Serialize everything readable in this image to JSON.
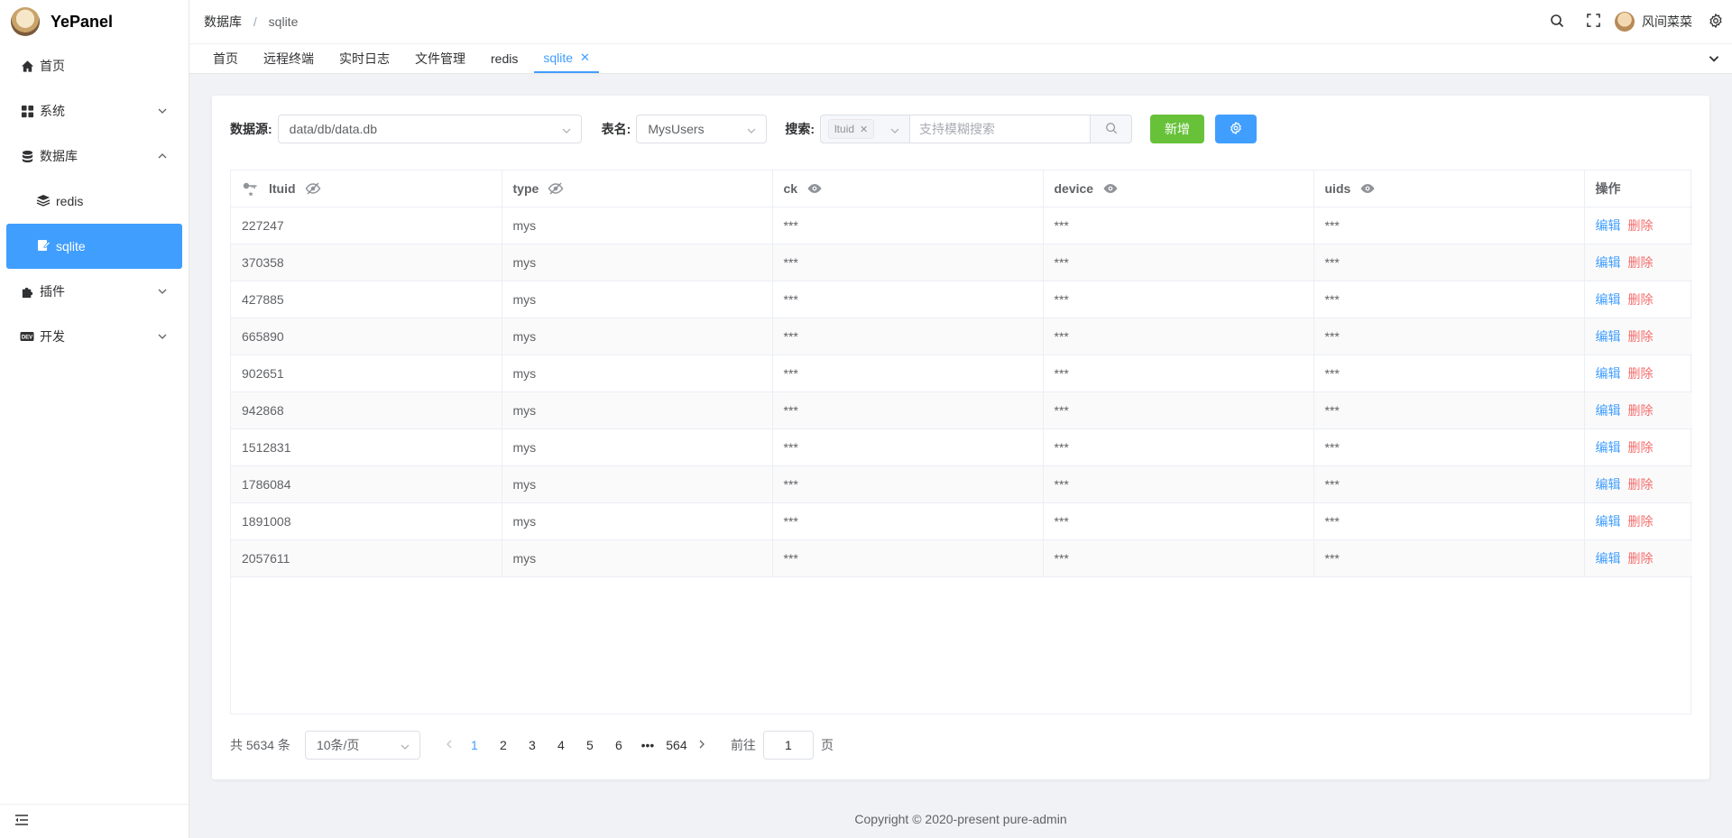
{
  "app": {
    "title": "YePanel"
  },
  "sidebar": {
    "items": [
      {
        "label": "首页",
        "icon": "home-icon"
      },
      {
        "label": "系统",
        "icon": "grid-icon"
      },
      {
        "label": "数据库",
        "icon": "database-icon"
      },
      {
        "label": "redis",
        "icon": "layers-icon"
      },
      {
        "label": "sqlite",
        "icon": "edit-doc-icon"
      },
      {
        "label": "插件",
        "icon": "puzzle-icon"
      },
      {
        "label": "开发",
        "icon": "dev-icon"
      }
    ]
  },
  "header": {
    "breadcrumb": [
      "数据库",
      "sqlite"
    ],
    "breadcrumb_sep": "/",
    "user_name": "风间菜菜"
  },
  "tabs": {
    "items": [
      "首页",
      "远程终端",
      "实时日志",
      "文件管理",
      "redis",
      "sqlite"
    ],
    "active": "sqlite",
    "close_glyph": "✕"
  },
  "toolbar": {
    "datasource_label": "数据源:",
    "datasource_value": "data/db/data.db",
    "table_label": "表名:",
    "table_value": "MysUsers",
    "search_label": "搜索:",
    "search_field_tag": "ltuid",
    "search_placeholder": "支持模糊搜索",
    "add_label": "新增"
  },
  "table": {
    "headers": [
      "ltuid",
      "type",
      "ck",
      "device",
      "uids",
      "操作"
    ],
    "rows": [
      [
        "227247",
        "mys",
        "***",
        "***",
        "***"
      ],
      [
        "370358",
        "mys",
        "***",
        "***",
        "***"
      ],
      [
        "427885",
        "mys",
        "***",
        "***",
        "***"
      ],
      [
        "665890",
        "mys",
        "***",
        "***",
        "***"
      ],
      [
        "902651",
        "mys",
        "***",
        "***",
        "***"
      ],
      [
        "942868",
        "mys",
        "***",
        "***",
        "***"
      ],
      [
        "1512831",
        "mys",
        "***",
        "***",
        "***"
      ],
      [
        "1786084",
        "mys",
        "***",
        "***",
        "***"
      ],
      [
        "1891008",
        "mys",
        "***",
        "***",
        "***"
      ],
      [
        "2057611",
        "mys",
        "***",
        "***",
        "***"
      ]
    ],
    "edit_label": "编辑",
    "delete_label": "删除"
  },
  "pagination": {
    "total_text": "共 5634 条",
    "page_size": "10条/页",
    "pages": [
      "1",
      "2",
      "3",
      "4",
      "5",
      "6",
      "•••",
      "564"
    ],
    "current": "1",
    "goto_label": "前往",
    "goto_value": "1",
    "page_suffix": "页"
  },
  "footer": {
    "text": "Copyright © 2020-present pure-admin"
  },
  "colors": {
    "primary": "#409eff",
    "success": "#67c23a",
    "danger": "#f56c6c"
  }
}
